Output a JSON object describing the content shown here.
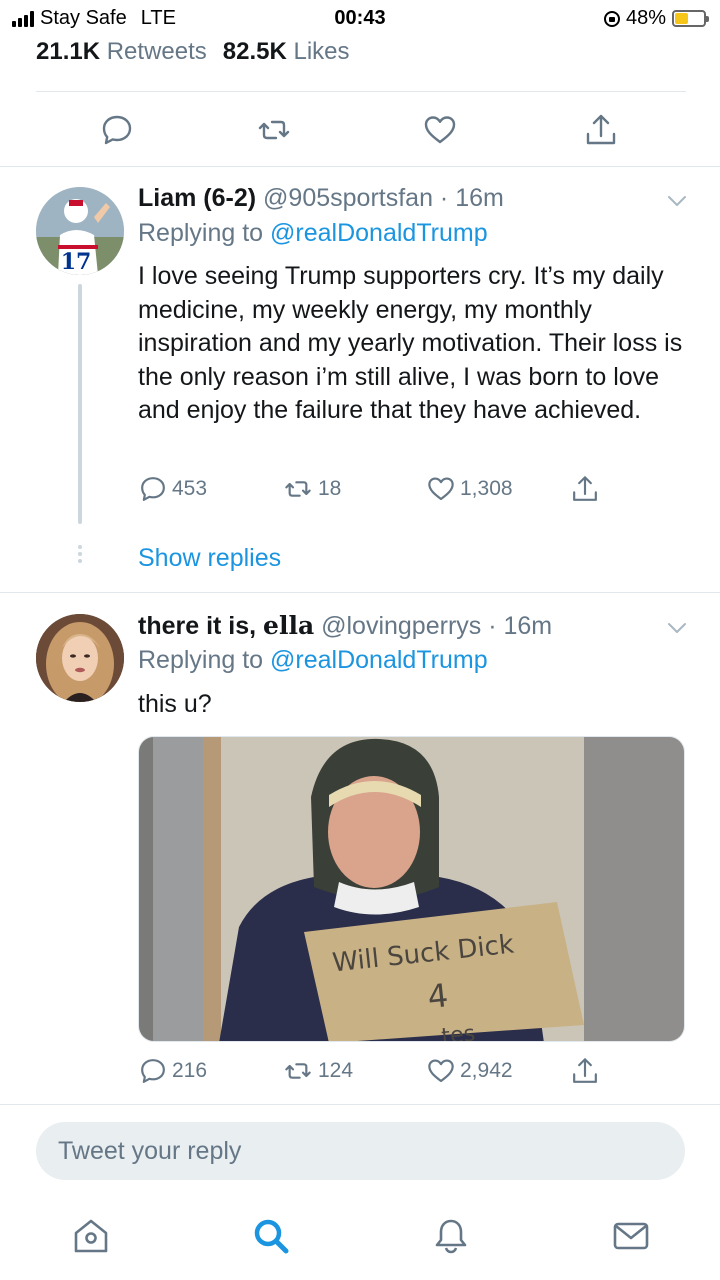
{
  "status_bar": {
    "carrier": "Stay Safe",
    "network": "LTE",
    "time": "00:43",
    "battery": "48%",
    "battery_level": 0.48
  },
  "stats": {
    "retweets_count": "21.1K",
    "retweets_label": "Retweets",
    "likes_count": "82.5K",
    "likes_label": "Likes"
  },
  "colors": {
    "link": "#1b95e0",
    "secondary_text": "#657786",
    "divider": "#e1e8ed",
    "battery_fill": "#f5c518"
  },
  "main_actions": [
    "reply-icon",
    "retweet-icon",
    "like-icon",
    "share-icon"
  ],
  "tweets": [
    {
      "name": "Liam (6-2)",
      "handle": "@905sportsfan",
      "time": "· 16m",
      "replying_label": "Replying to",
      "replying_to": "@realDonaldTrump",
      "text": "I love seeing Trump supporters cry. It’s my daily medicine, my weekly energy, my monthly inspiration and my yearly motivation. Their loss is the only reason i’m still alive, I was born to love and enjoy the failure that they have achieved.",
      "replies": "453",
      "retweets": "18",
      "likes": "1,308",
      "show_replies": "Show replies",
      "avatar_jersey": "17"
    },
    {
      "name": "there it is,",
      "name_script": "ella",
      "handle": "@lovingperrys",
      "time": "· 16m",
      "replying_label": "Replying to",
      "replying_to": "@realDonaldTrump",
      "text": "this u?",
      "sign_line1": "Will Suck Dick",
      "sign_line2": "4",
      "sign_line3": "tes",
      "replies": "216",
      "retweets": "124",
      "likes": "2,942"
    }
  ],
  "reply_box": {
    "placeholder": "Tweet your reply"
  },
  "tab_bar": [
    "home-icon",
    "search-icon",
    "notifications-icon",
    "messages-icon"
  ]
}
